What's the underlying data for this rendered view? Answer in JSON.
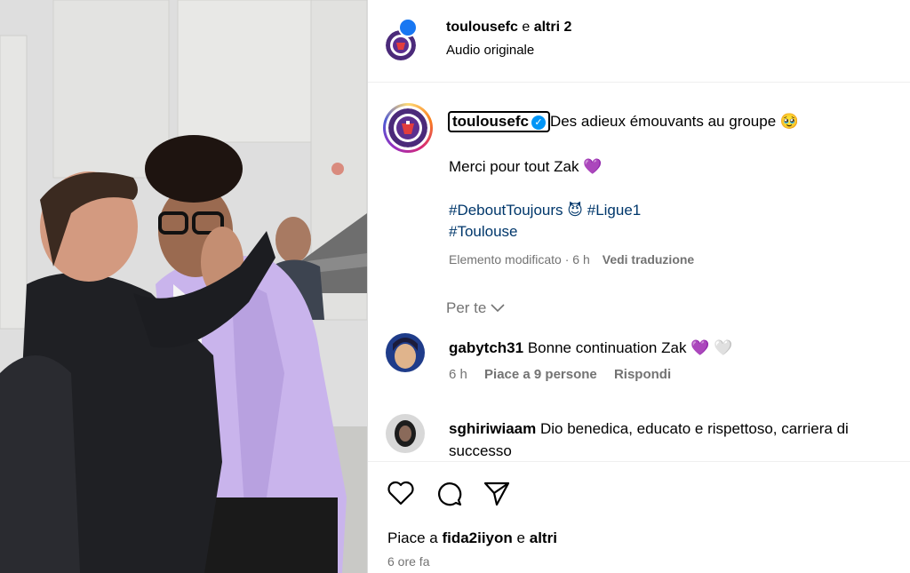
{
  "header": {
    "username": "toulousefc",
    "connector": "e",
    "others": "altri 2",
    "audio": "Audio originale"
  },
  "caption": {
    "username": "toulousefc",
    "verified_mark": "✓",
    "line1": "Des adieux émouvants au groupe",
    "line1_emoji": "🥹",
    "line2": "Merci pour tout Zak",
    "line2_emoji": "💜",
    "hashtag1": "#DeboutToujours",
    "hashtag1_emoji": "😈",
    "hashtag2": "#Ligue1",
    "hashtag3": "#Toulouse",
    "meta_status": "Elemento modificato · 6 h",
    "translate": "Vedi traduzione",
    "per_te": "Per te"
  },
  "comments": [
    {
      "username": "gabytch31",
      "text": "Bonne continuation Zak",
      "emojis": "💜 🤍",
      "time": "6 h",
      "likes": "Piace a 9 persone",
      "reply": "Rispondi"
    },
    {
      "username": "sghiriwiaam",
      "text": "Dio benedica, educato e rispettoso, carriera di successo"
    }
  ],
  "footer": {
    "likes_prefix": "Piace a",
    "likes_user": "fida2iiyon",
    "likes_connector": "e",
    "likes_others": "altri",
    "time_ago": "6 ore fa"
  },
  "colors": {
    "link": "#00376b",
    "secondary": "#737373",
    "verified": "#0095f6",
    "club_purple": "#4b2a7a"
  }
}
